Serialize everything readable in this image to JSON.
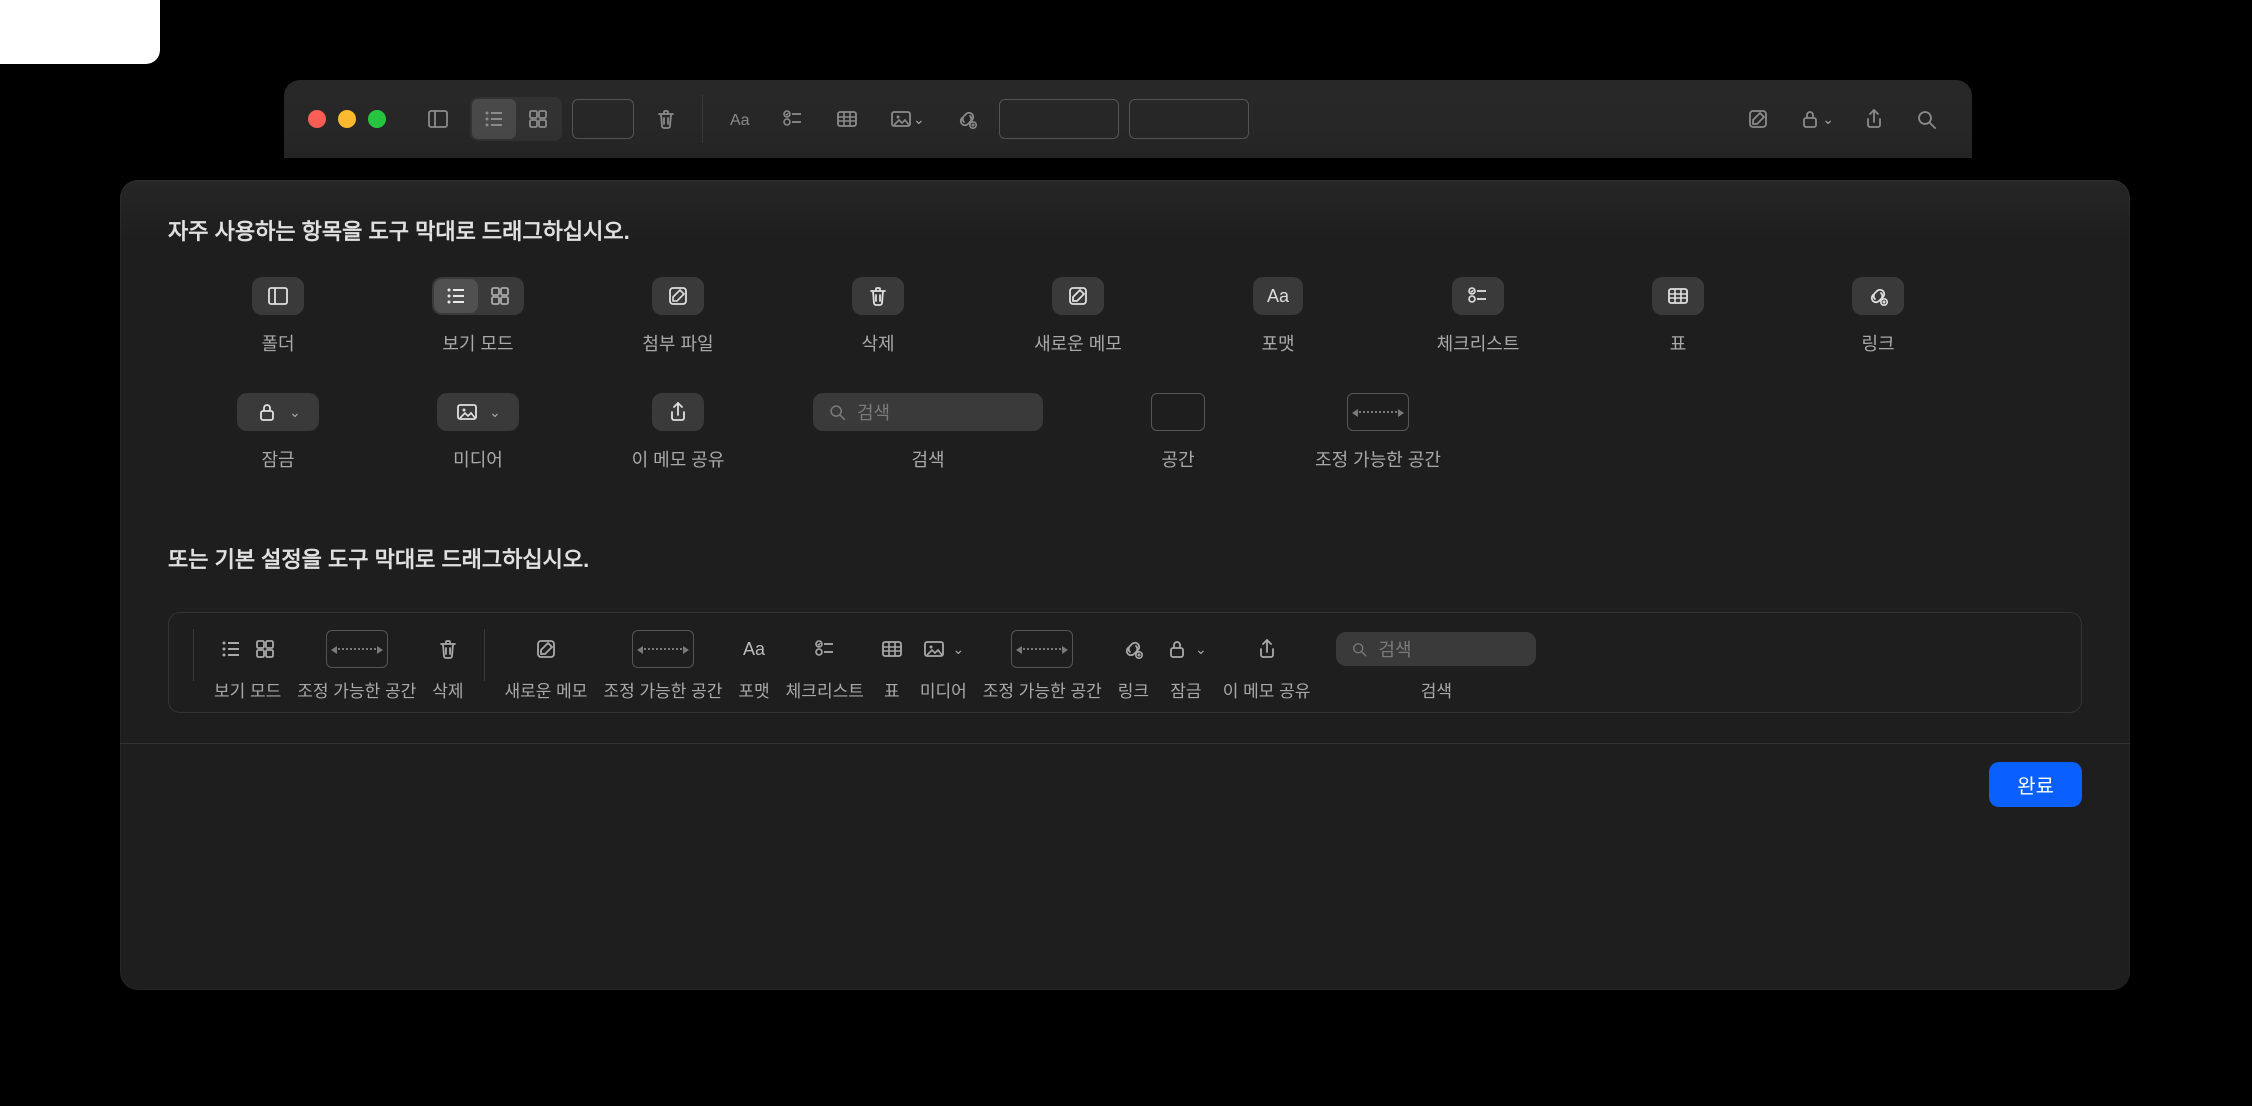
{
  "app": {
    "toolbar": {
      "traffic_lights": [
        "close",
        "minimize",
        "zoom"
      ]
    }
  },
  "sheet": {
    "heading_favorites": "자주 사용하는 항목을 도구 막대로 드래그하십시오.",
    "heading_default": "또는 기본 설정을 도구 막대로 드래그하십시오.",
    "done_label": "완료",
    "search_placeholder": "검색",
    "items": {
      "folder": {
        "label": "폴더"
      },
      "view_mode": {
        "label": "보기 모드"
      },
      "attachments": {
        "label": "첨부 파일"
      },
      "delete": {
        "label": "삭제"
      },
      "new_note": {
        "label": "새로운 메모"
      },
      "format": {
        "label": "포맷"
      },
      "checklist": {
        "label": "체크리스트"
      },
      "table": {
        "label": "표"
      },
      "link": {
        "label": "링크"
      },
      "lock": {
        "label": "잠금"
      },
      "media": {
        "label": "미디어"
      },
      "share_note": {
        "label": "이 메모 공유"
      },
      "search": {
        "label": "검색"
      },
      "space": {
        "label": "공간"
      },
      "flex_space": {
        "label": "조정 가능한 공간"
      }
    },
    "default_set": {
      "view_mode": {
        "label": "보기 모드"
      },
      "flex_space1": {
        "label": "조정 가능한 공간"
      },
      "delete": {
        "label": "삭제"
      },
      "new_note": {
        "label": "새로운 메모"
      },
      "flex_space2": {
        "label": "조정 가능한 공간"
      },
      "format": {
        "label": "포맷"
      },
      "checklist": {
        "label": "체크리스트"
      },
      "table": {
        "label": "표"
      },
      "media": {
        "label": "미디어"
      },
      "flex_space3": {
        "label": "조정 가능한 공간"
      },
      "link": {
        "label": "링크"
      },
      "lock": {
        "label": "잠금"
      },
      "share_note": {
        "label": "이 메모 공유"
      },
      "search": {
        "label": "검색"
      }
    }
  }
}
